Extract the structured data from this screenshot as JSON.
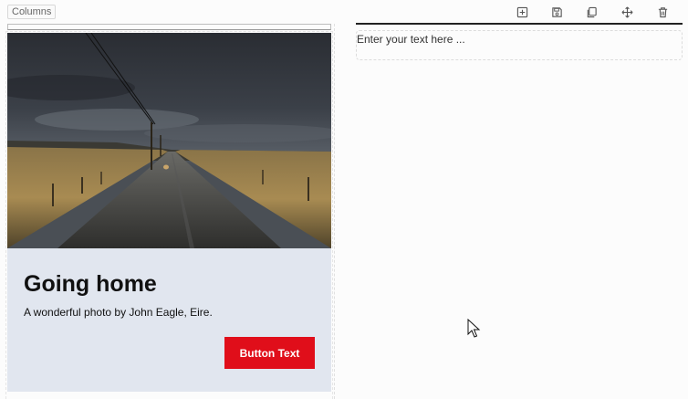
{
  "editor": {
    "block_label": "Columns",
    "toolbar": [
      {
        "name": "add-icon",
        "tooltip": ""
      },
      {
        "name": "save-icon",
        "tooltip": ""
      },
      {
        "name": "duplicate-icon",
        "tooltip": ""
      },
      {
        "name": "move-icon",
        "tooltip": ""
      },
      {
        "name": "delete-icon",
        "tooltip": ""
      }
    ],
    "text_placeholder": "Enter your text here ..."
  },
  "card": {
    "image_icon": "country-road-photo",
    "title": "Going home",
    "text": "A wonderful photo by John Eagle, Eire.",
    "button_label": "Button Text",
    "colors": {
      "panel_background": "#e1e6ef",
      "button_background": "#e00e1a",
      "button_text": "#ffffff"
    }
  }
}
